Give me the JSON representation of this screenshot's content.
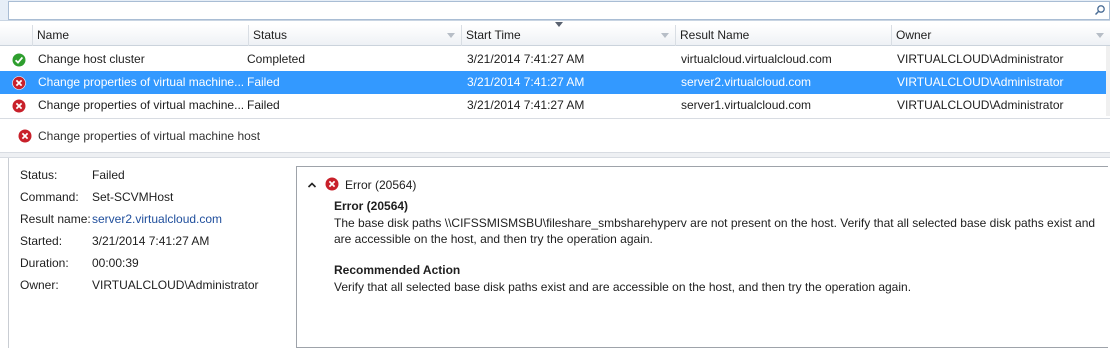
{
  "search": {
    "placeholder": "",
    "icon": "search-icon"
  },
  "grid": {
    "columns": [
      "Name",
      "Status",
      "Start Time",
      "Result Name",
      "Owner"
    ],
    "rows": [
      {
        "status_type": "success",
        "name": "Change host cluster",
        "status": "Completed",
        "start_time": "3/21/2014 7:41:27 AM",
        "result_name": "virtualcloud.virtualcloud.com",
        "owner": "VIRTUALCLOUD\\Administrator",
        "selected": false
      },
      {
        "status_type": "error",
        "name": "Change properties of virtual machine...",
        "status": "Failed",
        "start_time": "3/21/2014 7:41:27 AM",
        "result_name": "server2.virtualcloud.com",
        "owner": "VIRTUALCLOUD\\Administrator",
        "selected": true
      },
      {
        "status_type": "error",
        "name": "Change properties of virtual machine...",
        "status": "Failed",
        "start_time": "3/21/2014 7:41:27 AM",
        "result_name": "server1.virtualcloud.com",
        "owner": "VIRTUALCLOUD\\Administrator",
        "selected": false
      }
    ]
  },
  "details": {
    "title": "Change properties of virtual machine host",
    "fields": [
      {
        "key": "Status:",
        "value": "Failed",
        "link": false
      },
      {
        "key": "Command:",
        "value": "Set-SCVMHost",
        "link": false
      },
      {
        "key": "Result name:",
        "value": "server2.virtualcloud.com",
        "link": true
      },
      {
        "key": "Started:",
        "value": "3/21/2014 7:41:27 AM",
        "link": false
      },
      {
        "key": "Duration:",
        "value": "00:00:39",
        "link": false
      },
      {
        "key": "Owner:",
        "value": "VIRTUALCLOUD\\Administrator",
        "link": false
      }
    ]
  },
  "error": {
    "header": "Error (20564)",
    "title": "Error (20564)",
    "message": "The base disk paths \\\\CIFSSMISMSBU\\fileshare_smbsharehyperv are not present on the host. Verify that all selected base disk paths exist and are accessible on the host, and then try the operation again.",
    "recommended_title": "Recommended Action",
    "recommended_text": "Verify that all selected base disk paths exist and are accessible on the host, and then try the operation again."
  },
  "colors": {
    "selection": "#3399ff",
    "success": "#2e9e2e",
    "error": "#c8202a",
    "link": "#1f4e9c"
  }
}
